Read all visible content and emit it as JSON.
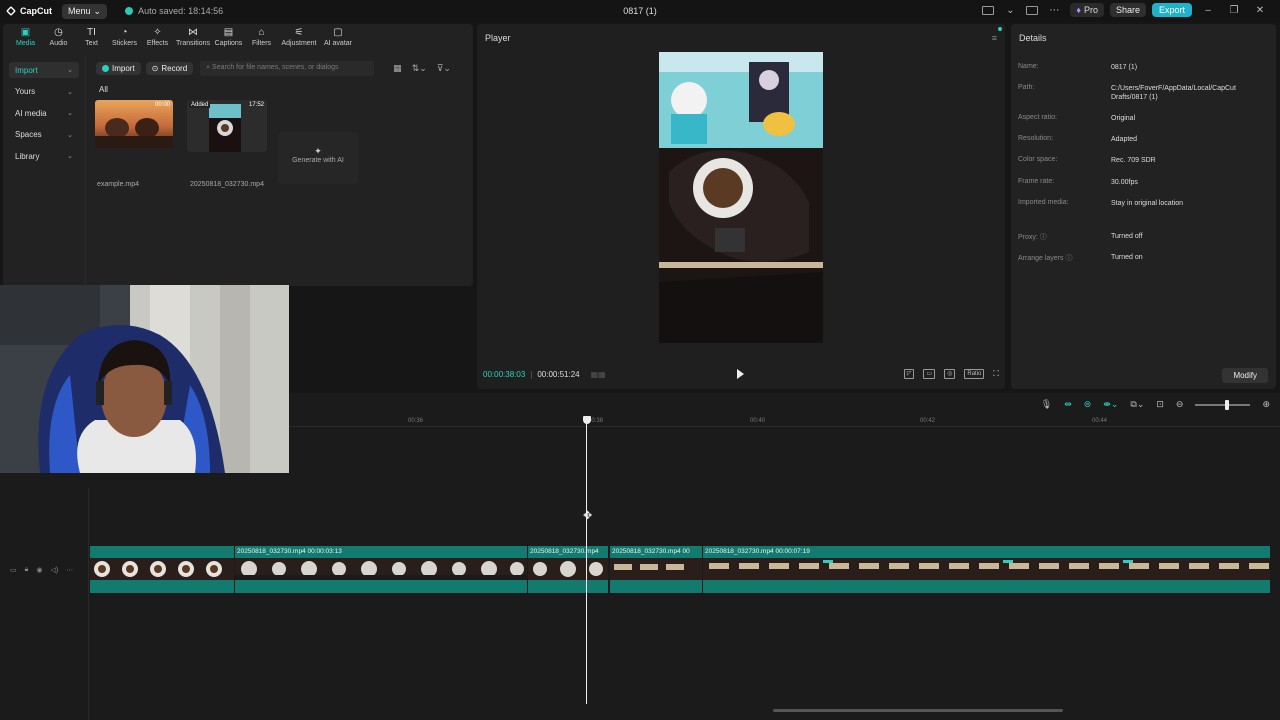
{
  "app": {
    "name": "CapCut",
    "menu_label": "Menu",
    "autosave_text": "Auto saved: 18:14:56",
    "project_title": "0817 (1)",
    "pro_label": "Pro",
    "share_label": "Share",
    "export_label": "Export"
  },
  "toolbar": {
    "items": [
      {
        "label": "Media",
        "icon": "media-icon"
      },
      {
        "label": "Audio",
        "icon": "audio-icon"
      },
      {
        "label": "Text",
        "icon": "text-icon"
      },
      {
        "label": "Stickers",
        "icon": "stickers-icon"
      },
      {
        "label": "Effects",
        "icon": "effects-icon"
      },
      {
        "label": "Transitions",
        "icon": "transitions-icon"
      },
      {
        "label": "Captions",
        "icon": "captions-icon"
      },
      {
        "label": "Filters",
        "icon": "filters-icon"
      },
      {
        "label": "Adjustment",
        "icon": "adjustment-icon"
      },
      {
        "label": "AI avatar",
        "icon": "ai-avatar-icon"
      }
    ],
    "active_index": 0
  },
  "media_sidebar": {
    "items": [
      "Import",
      "Yours",
      "AI media",
      "Spaces",
      "Library"
    ]
  },
  "media": {
    "import_label": "Import",
    "record_label": "Record",
    "search_placeholder": "Search for file names, scenes, or dialogs",
    "all_tab": "All",
    "items": [
      {
        "name": "example.mp4",
        "duration": "00:00",
        "added": ""
      },
      {
        "name": "20250818_032730.mp4",
        "duration": "17:52",
        "added": "Added"
      }
    ],
    "generate_ai_label": "Generate with AI"
  },
  "player": {
    "title": "Player",
    "current_time": "00:00:38:03",
    "total_time": "00:00:51:24",
    "ratio_label": "Ratio"
  },
  "details": {
    "title": "Details",
    "rows": [
      {
        "label": "Name:",
        "value": "0817 (1)"
      },
      {
        "label": "Path:",
        "value": "C:/Users/FoverF/AppData/Local/CapCut Drafts/0817 (1)"
      },
      {
        "label": "Aspect ratio:",
        "value": "Original"
      },
      {
        "label": "Resolution:",
        "value": "Adapted"
      },
      {
        "label": "Color space:",
        "value": "Rec. 709 SDR"
      },
      {
        "label": "Frame rate:",
        "value": "30.00fps"
      },
      {
        "label": "Imported media:",
        "value": "Stay in original location"
      },
      {
        "label": "Proxy:",
        "value": "Turned off"
      },
      {
        "label": "Arrange layers",
        "value": "Turned on"
      }
    ],
    "modify_label": "Modify"
  },
  "timeline": {
    "ruler_ticks": [
      "00:36",
      "00:38",
      "00:40",
      "00:42",
      "00:44"
    ],
    "clips": [
      {
        "label": ""
      },
      {
        "label": "20250818_032730.mp4   00:00:03:13"
      },
      {
        "label": "20250818_032730.mp4"
      },
      {
        "label": "20250818_032730.mp4   00"
      },
      {
        "label": "20250818_032730.mp4   00:00:07:19"
      }
    ]
  }
}
